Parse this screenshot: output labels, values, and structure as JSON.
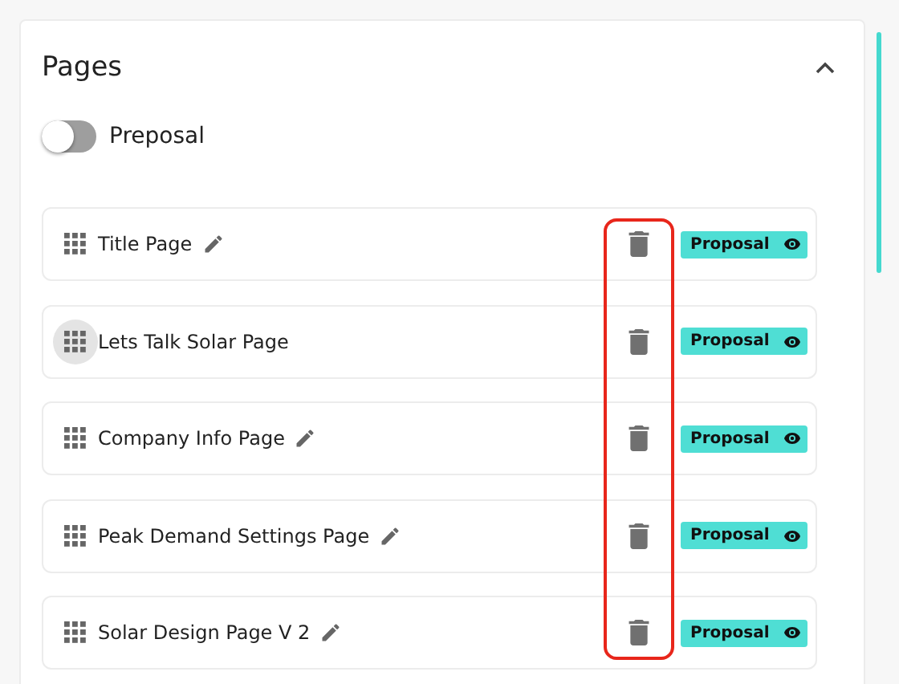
{
  "section": {
    "title": "Pages",
    "expanded": true
  },
  "toggle": {
    "label": "Preposal",
    "on": false
  },
  "pages": [
    {
      "name": "Title Page",
      "editable": true,
      "handle_hovered": false,
      "badge": "Proposal"
    },
    {
      "name": "Lets Talk Solar Page",
      "editable": false,
      "handle_hovered": true,
      "badge": "Proposal"
    },
    {
      "name": "Company Info Page",
      "editable": true,
      "handle_hovered": false,
      "badge": "Proposal"
    },
    {
      "name": "Peak Demand Settings Page",
      "editable": true,
      "handle_hovered": false,
      "badge": "Proposal"
    },
    {
      "name": "Solar Design Page V 2",
      "editable": true,
      "handle_hovered": false,
      "badge": "Proposal"
    }
  ]
}
